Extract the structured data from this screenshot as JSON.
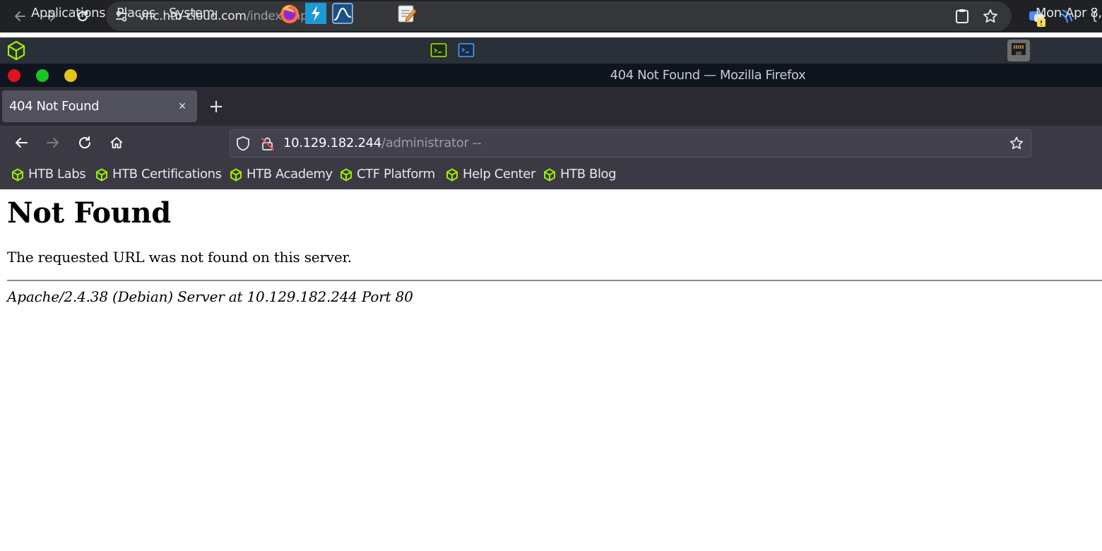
{
  "chrome": {
    "url_host": "vnc.htb-cloud.com",
    "url_path": "/index.php",
    "icons": [
      "back-arrow-icon",
      "forward-arrow-icon",
      "reload-icon",
      "site-info-icon",
      "clipboard-icon",
      "star-icon",
      "extension-icon",
      "extension-icon"
    ]
  },
  "panel": {
    "menus": [
      "Applications",
      "Places",
      "System"
    ],
    "launchers": [
      "firefox-icon",
      "burp-suite-icon",
      "wireshark-icon",
      "text-editor-icon",
      "terminal-icon",
      "powershell-icon"
    ],
    "clock": "Mon Apr  8,"
  },
  "firefox": {
    "window_title": "404 Not Found — Mozilla Firefox",
    "tab_title": "404 Not Found",
    "tab_close": "×",
    "new_tab": "+",
    "url_host": "10.129.182.244",
    "url_path": "/administrator --",
    "bookmarks": [
      "HTB Labs",
      "HTB Certifications",
      "HTB Academy",
      "CTF Platform",
      "Help Center",
      "HTB Blog"
    ],
    "colors": {
      "bookmark_icon": "#9fef00",
      "window_close": "#e0121b",
      "window_maximize": "#18c428",
      "window_minimize": "#e4c414"
    }
  },
  "page": {
    "heading": "Not Found",
    "message": "The requested URL was not found on this server.",
    "address": "Apache/2.4.38 (Debian) Server at 10.129.182.244 Port 80"
  }
}
